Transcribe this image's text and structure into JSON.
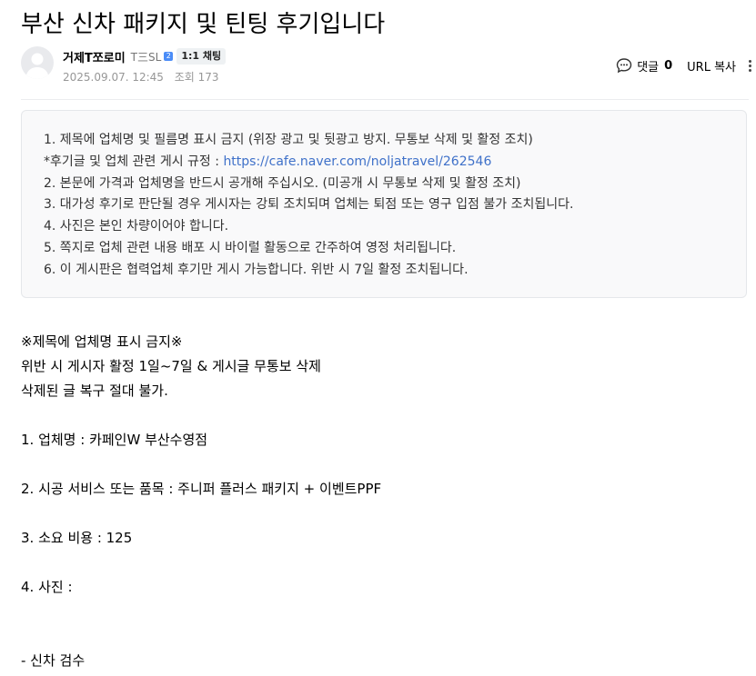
{
  "post": {
    "title": "부산 신차 패키지 및 틴팅 후기입니다",
    "author": {
      "nickname": "거제T쪼로미",
      "level_label": "T三SL",
      "level_badge": "2",
      "chat_label": "1:1 채팅"
    },
    "date": "2025.09.07. 12:45",
    "views": "조회 173",
    "actions": {
      "comment_label": "댓글",
      "comment_count": "0",
      "url_copy_label": "URL 복사"
    }
  },
  "notice": {
    "line1": "1. 제목에 업체명 및 필름명 표시 금지 (위장 광고 및 뒷광고 방지. 무통보 삭제 및 활정 조치)",
    "line2_prefix": "*후기글 및 업체 관련 게시 규정 : ",
    "line2_link": "https://cafe.naver.com/noljatravel/262546",
    "line3": "2. 본문에 가격과 업체명을 반드시 공개해 주십시오. (미공개 시 무통보 삭제 및 활정 조치)",
    "line4": "3. 대가성 후기로 판단될 경우 게시자는 강퇴 조치되며 업체는 퇴점 또는 영구 입점 불가 조치됩니다.",
    "line5": "4. 사진은 본인 차량이어야 합니다.",
    "line6": "5. 쪽지로 업체 관련 내용 배포 시 바이럴 활동으로 간주하여 영정 처리됩니다.",
    "line7": "6. 이 게시판은 협력업체 후기만 게시 가능합니다. 위반 시 7일 활정 조치됩니다."
  },
  "content": {
    "warning_title": "※제목에 업체명 표시 금지※",
    "warning_line1": "위반 시 게시자 활정 1일~7일 & 게시글 무통보 삭제",
    "warning_line2": "삭제된 글 복구 절대 불가.",
    "q1": "1. 업체명 :  카페인W 부산수영점",
    "q2": "2. 시공 서비스 또는 품목 :  주니퍼 플러스 패키지 + 이벤트PPF",
    "q3": "3. 소요 비용 :  125",
    "q4": "4. 사진 :",
    "section1": "- 신차 검수"
  }
}
